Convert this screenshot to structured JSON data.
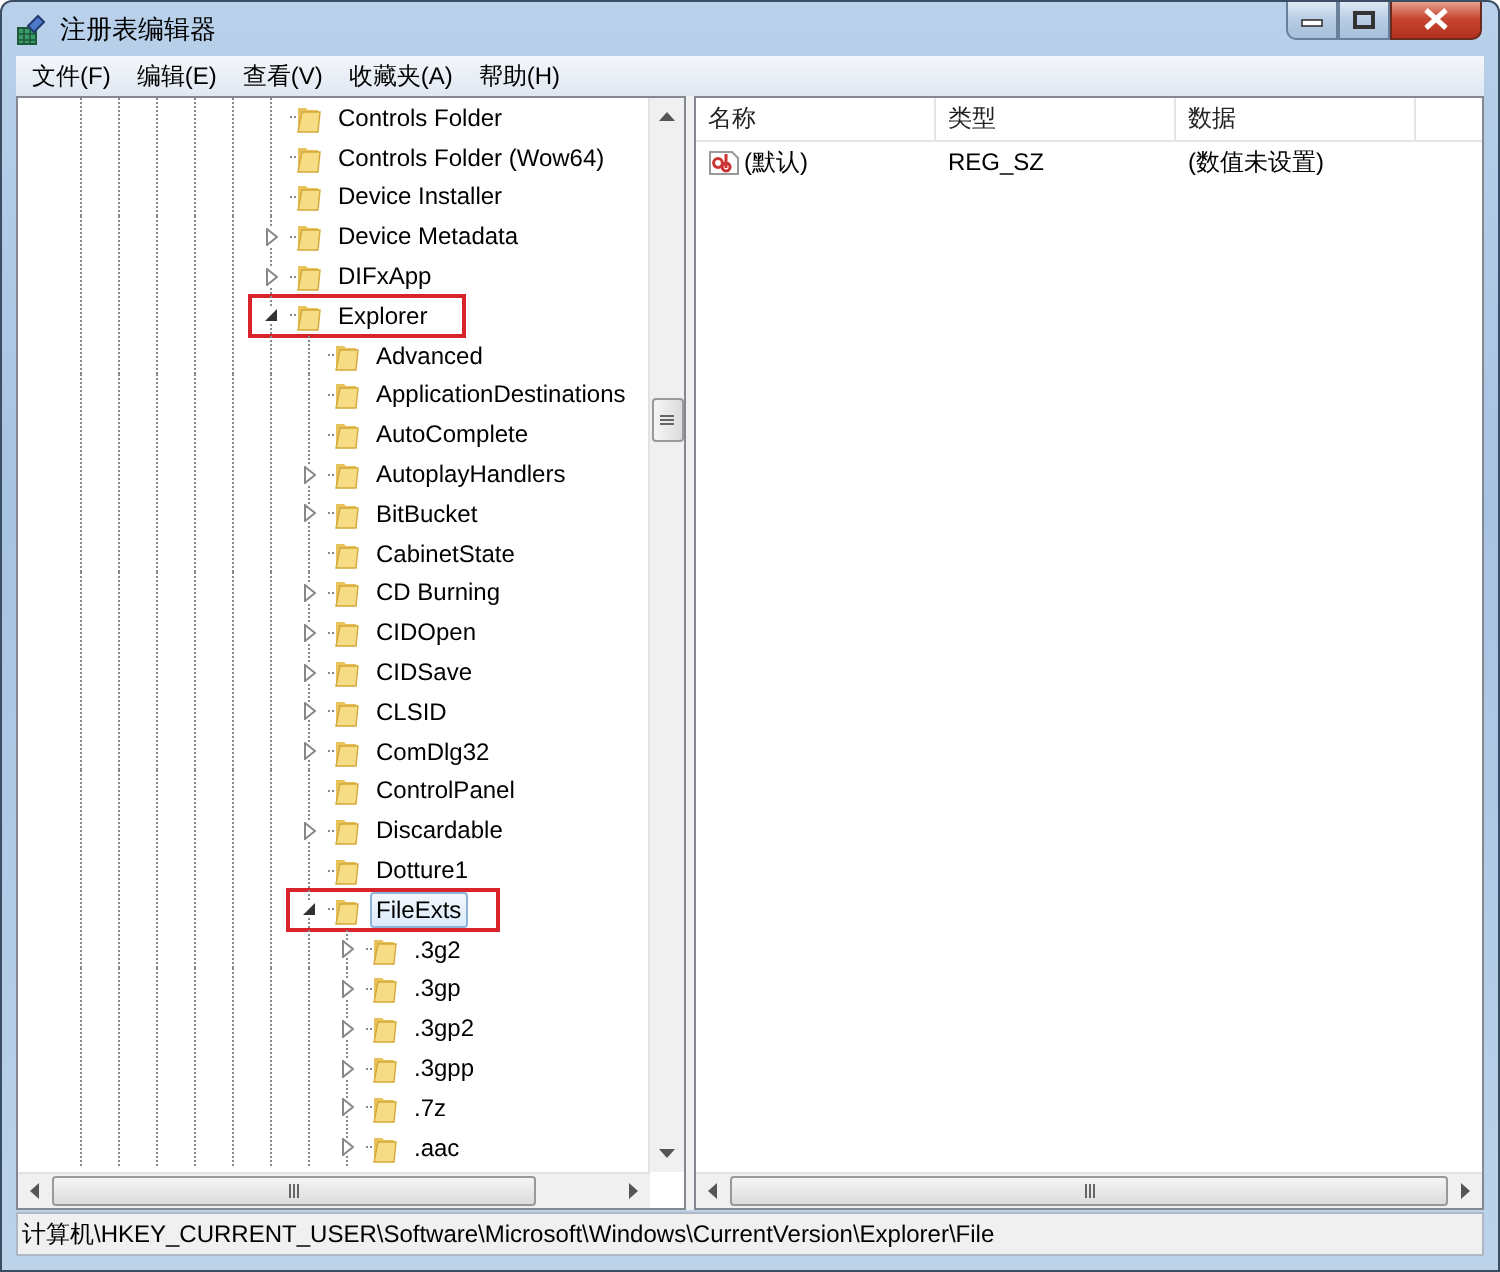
{
  "window": {
    "title": "注册表编辑器"
  },
  "menu": [
    "文件(F)",
    "编辑(E)",
    "查看(V)",
    "收藏夹(A)",
    "帮助(H)"
  ],
  "tree": [
    {
      "label": "Controls Folder",
      "expandable": false,
      "expanded": false,
      "selected": false,
      "annotated": false
    },
    {
      "label": "Controls Folder (Wow64)",
      "expandable": false,
      "expanded": false,
      "selected": false,
      "annotated": false
    },
    {
      "label": "Device Installer",
      "expandable": false,
      "expanded": false,
      "selected": false,
      "annotated": false
    },
    {
      "label": "Device Metadata",
      "expandable": true,
      "expanded": false,
      "selected": false,
      "annotated": false
    },
    {
      "label": "DIFxApp",
      "expandable": true,
      "expanded": false,
      "selected": false,
      "annotated": false
    },
    {
      "label": "Explorer",
      "expandable": true,
      "expanded": true,
      "selected": false,
      "annotated": true,
      "children": [
        {
          "label": "Advanced",
          "expandable": false,
          "expanded": false,
          "selected": false,
          "annotated": false
        },
        {
          "label": "ApplicationDestinations",
          "expandable": false,
          "expanded": false,
          "selected": false,
          "annotated": false
        },
        {
          "label": "AutoComplete",
          "expandable": false,
          "expanded": false,
          "selected": false,
          "annotated": false
        },
        {
          "label": "AutoplayHandlers",
          "expandable": true,
          "expanded": false,
          "selected": false,
          "annotated": false
        },
        {
          "label": "BitBucket",
          "expandable": true,
          "expanded": false,
          "selected": false,
          "annotated": false
        },
        {
          "label": "CabinetState",
          "expandable": false,
          "expanded": false,
          "selected": false,
          "annotated": false
        },
        {
          "label": "CD Burning",
          "expandable": true,
          "expanded": false,
          "selected": false,
          "annotated": false
        },
        {
          "label": "CIDOpen",
          "expandable": true,
          "expanded": false,
          "selected": false,
          "annotated": false
        },
        {
          "label": "CIDSave",
          "expandable": true,
          "expanded": false,
          "selected": false,
          "annotated": false
        },
        {
          "label": "CLSID",
          "expandable": true,
          "expanded": false,
          "selected": false,
          "annotated": false
        },
        {
          "label": "ComDlg32",
          "expandable": true,
          "expanded": false,
          "selected": false,
          "annotated": false
        },
        {
          "label": "ControlPanel",
          "expandable": false,
          "expanded": false,
          "selected": false,
          "annotated": false
        },
        {
          "label": "Discardable",
          "expandable": true,
          "expanded": false,
          "selected": false,
          "annotated": false
        },
        {
          "label": "Dotture1",
          "expandable": false,
          "expanded": false,
          "selected": false,
          "annotated": false
        },
        {
          "label": "FileExts",
          "expandable": true,
          "expanded": true,
          "selected": true,
          "annotated": true,
          "children": [
            {
              "label": ".3g2",
              "expandable": true,
              "expanded": false,
              "selected": false,
              "annotated": false
            },
            {
              "label": ".3gp",
              "expandable": true,
              "expanded": false,
              "selected": false,
              "annotated": false
            },
            {
              "label": ".3gp2",
              "expandable": true,
              "expanded": false,
              "selected": false,
              "annotated": false
            },
            {
              "label": ".3gpp",
              "expandable": true,
              "expanded": false,
              "selected": false,
              "annotated": false
            },
            {
              "label": ".7z",
              "expandable": true,
              "expanded": false,
              "selected": false,
              "annotated": false
            },
            {
              "label": ".aac",
              "expandable": true,
              "expanded": false,
              "selected": false,
              "annotated": false
            }
          ]
        }
      ]
    }
  ],
  "values_list": {
    "columns": [
      "名称",
      "类型",
      "数据"
    ],
    "rows": [
      {
        "name": "(默认)",
        "type": "REG_SZ",
        "data": "(数值未设置)"
      }
    ]
  },
  "status_bar": "计算机\\HKEY_CURRENT_USER\\Software\\Microsoft\\Windows\\CurrentVersion\\Explorer\\File"
}
